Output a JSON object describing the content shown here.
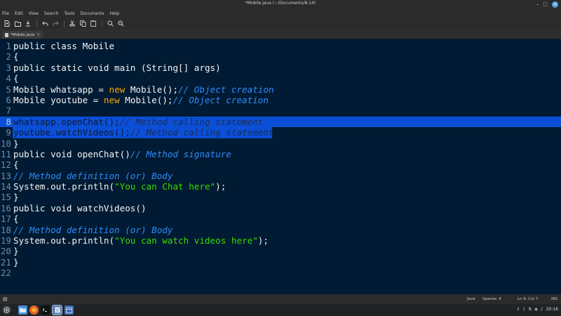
{
  "window": {
    "title": "*Mobile.java (~/Documents/8-14)",
    "min_glyph": "–",
    "max_glyph": "▢",
    "close_glyph": "✕"
  },
  "menu": [
    "File",
    "Edit",
    "View",
    "Search",
    "Tools",
    "Documents",
    "Help"
  ],
  "toolbar": {
    "icons": [
      "new-file-icon",
      "open-file-icon",
      "save-icon",
      "undo-icon",
      "redo-icon",
      "cut-icon",
      "copy-icon",
      "paste-icon",
      "search-icon",
      "replace-icon"
    ]
  },
  "tab": {
    "label": "*Mobile.java",
    "close_glyph": "×"
  },
  "editor": {
    "lines": [
      {
        "n": "1",
        "parts": [
          [
            "t",
            "public class Mobile"
          ]
        ]
      },
      {
        "n": "2",
        "parts": [
          [
            "t",
            "{"
          ]
        ]
      },
      {
        "n": "3",
        "parts": [
          [
            "t",
            "public static void main (String[] args)"
          ]
        ]
      },
      {
        "n": "4",
        "parts": [
          [
            "t",
            "{"
          ]
        ]
      },
      {
        "n": "5",
        "parts": [
          [
            "t",
            "Mobile whatsapp = "
          ],
          [
            "k",
            "new"
          ],
          [
            "t",
            " Mobile();"
          ],
          [
            "c",
            "// Object creation"
          ]
        ]
      },
      {
        "n": "6",
        "parts": [
          [
            "t",
            "Mobile youtube = "
          ],
          [
            "k",
            "new"
          ],
          [
            "t",
            " Mobile();"
          ],
          [
            "c",
            "// Object creation"
          ]
        ]
      },
      {
        "n": "7",
        "parts": [
          [
            "t",
            ""
          ]
        ]
      },
      {
        "n": "8",
        "sel": "full",
        "parts": [
          [
            "t",
            "whatsapp.openChat();"
          ],
          [
            "c",
            "// Method calling statement"
          ]
        ]
      },
      {
        "n": "9",
        "sel": "part",
        "parts": [
          [
            "t",
            "youtube.watchVideos();"
          ],
          [
            "c",
            "// Method calling statement"
          ]
        ]
      },
      {
        "n": "10",
        "parts": [
          [
            "t",
            "}"
          ]
        ]
      },
      {
        "n": "11",
        "parts": [
          [
            "t",
            "public void openChat()"
          ],
          [
            "c",
            "// Method signature"
          ]
        ]
      },
      {
        "n": "12",
        "parts": [
          [
            "t",
            "{"
          ]
        ]
      },
      {
        "n": "13",
        "parts": [
          [
            "c",
            "// Method definition (or) Body"
          ]
        ]
      },
      {
        "n": "14",
        "parts": [
          [
            "t",
            "System.out.println("
          ],
          [
            "s",
            "\"You can Chat here\""
          ],
          [
            "t",
            ");"
          ]
        ]
      },
      {
        "n": "15",
        "parts": [
          [
            "t",
            "}"
          ]
        ]
      },
      {
        "n": "16",
        "parts": [
          [
            "t",
            "public void watchVideos()"
          ]
        ]
      },
      {
        "n": "17",
        "parts": [
          [
            "t",
            "{"
          ]
        ]
      },
      {
        "n": "18",
        "parts": [
          [
            "c",
            "// Method definition (or) Body"
          ]
        ]
      },
      {
        "n": "19",
        "parts": [
          [
            "t",
            "System.out.println("
          ],
          [
            "s",
            "\"You can watch videos here\""
          ],
          [
            "t",
            ");"
          ]
        ]
      },
      {
        "n": "20",
        "parts": [
          [
            "t",
            "}"
          ]
        ]
      },
      {
        "n": "21",
        "parts": [
          [
            "t",
            "}"
          ]
        ]
      },
      {
        "n": "22",
        "parts": [
          [
            "t",
            ""
          ]
        ]
      }
    ]
  },
  "statusbar": {
    "language": "Java",
    "tab_width": "Spaces: 4",
    "position": "Ln 9, Col 7",
    "mode": "INS"
  },
  "taskbar": {
    "clock": "20:16",
    "apps": [
      "menu-icon",
      "files-icon",
      "firefox-icon",
      "terminal-icon",
      "text-editor-icon",
      "app-icon"
    ]
  },
  "colors": {
    "background": "#001b33",
    "keyword": "#ffa600",
    "comment": "#2f8cff",
    "string": "#3ad900",
    "selection": "#0b4fd6"
  }
}
